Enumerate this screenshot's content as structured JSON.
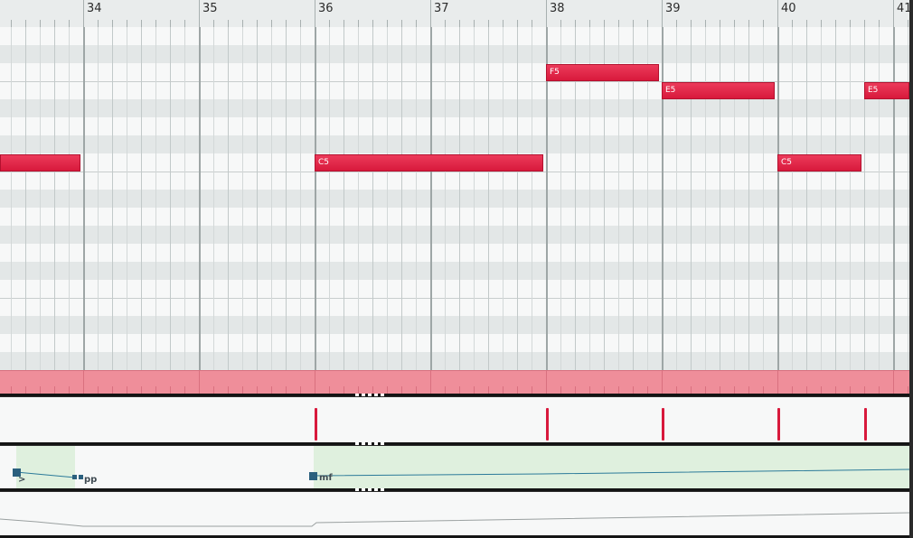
{
  "ruler": {
    "bars": [
      "34",
      "35",
      "36",
      "37",
      "38",
      "39",
      "40",
      "41"
    ]
  },
  "notes": [
    {
      "label": "",
      "pitch": "C5"
    },
    {
      "label": "C5",
      "pitch": "C5"
    },
    {
      "label": "F5",
      "pitch": "F5"
    },
    {
      "label": "E5",
      "pitch": "E5"
    },
    {
      "label": "C5",
      "pitch": "C5"
    },
    {
      "label": "E5",
      "pitch": "E5"
    }
  ],
  "dynamics": {
    "markings": [
      {
        "text": ">"
      },
      {
        "text": "pp"
      },
      {
        "text": "mf"
      }
    ]
  },
  "colors": {
    "note": "#d8193c",
    "track_strip": "#ef8e9a",
    "dynamics_fill": "#dff0de",
    "dynamics_line": "#2b7a99",
    "handle": "#2b607e"
  }
}
